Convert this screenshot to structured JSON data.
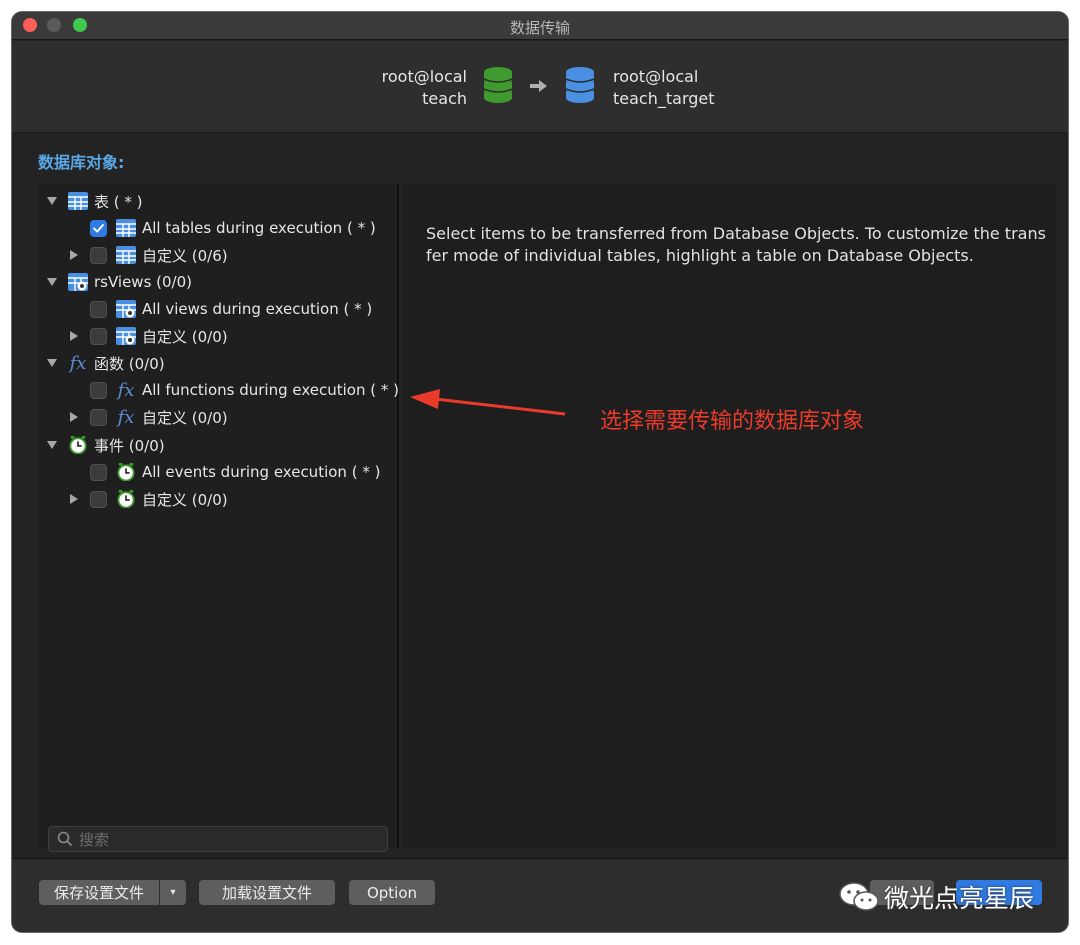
{
  "window": {
    "title": "数据传输"
  },
  "header": {
    "source": {
      "connection": "root@local",
      "database": "teach",
      "color": "#3f9b2f"
    },
    "target": {
      "connection": "root@local",
      "database": "teach_target",
      "color": "#4a90e2"
    }
  },
  "tree": {
    "section_label": "数据库对象:",
    "groups": [
      {
        "label": "表 ( * )",
        "icon": "table-icon",
        "items": [
          {
            "label": "All tables during execution ( * )",
            "checked": true,
            "icon": "table-icon"
          },
          {
            "label": "自定义 (0/6)",
            "checked": false,
            "icon": "table-icon"
          }
        ]
      },
      {
        "label": "rsViews (0/0)",
        "icon": "view-icon",
        "items": [
          {
            "label": "All views during execution ( * )",
            "checked": false,
            "icon": "view-icon"
          },
          {
            "label": "自定义 (0/0)",
            "checked": false,
            "icon": "view-icon"
          }
        ]
      },
      {
        "label": "函数 (0/0)",
        "icon": "function-icon",
        "items": [
          {
            "label": "All functions during execution ( * )",
            "checked": false,
            "icon": "function-icon"
          },
          {
            "label": "自定义 (0/0)",
            "checked": false,
            "icon": "function-icon"
          }
        ]
      },
      {
        "label": "事件 (0/0)",
        "icon": "clock-icon",
        "items": [
          {
            "label": "All events during execution ( * )",
            "checked": false,
            "icon": "clock-icon"
          },
          {
            "label": "自定义 (0/0)",
            "checked": false,
            "icon": "clock-icon"
          }
        ]
      }
    ],
    "search_placeholder": "搜索"
  },
  "info": {
    "text": "Select items to be transferred from Database Objects. To customize the transfer mode of individual tables, highlight a table on Database Objects."
  },
  "annotation": {
    "text": "选择需要传输的数据库对象",
    "color": "#ea3a2c"
  },
  "footer": {
    "save_label": "保存设置文件",
    "save_dropdown": "▾",
    "load_label": "加载设置文件",
    "option_label": "Option"
  },
  "watermark": {
    "text": "微光点亮星辰"
  },
  "colors": {
    "accent": "#2f7be3",
    "section_label": "#5aa7e6"
  }
}
